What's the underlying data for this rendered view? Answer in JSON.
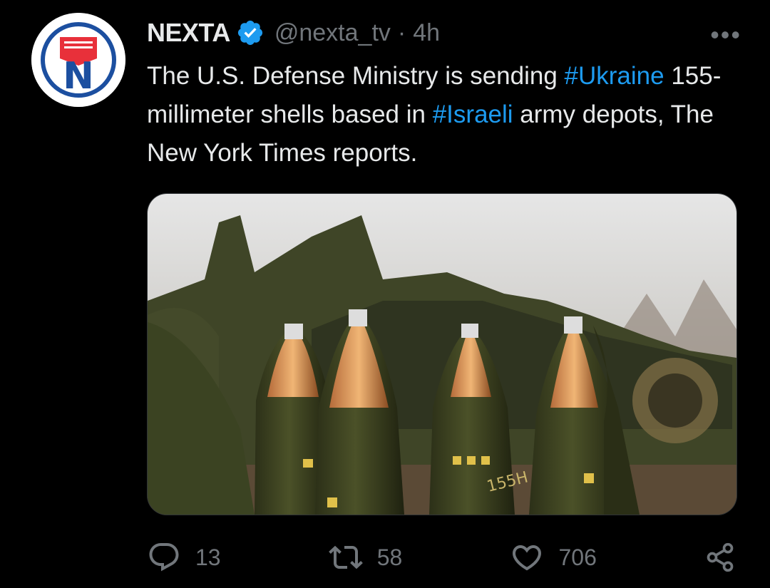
{
  "author": {
    "name": "NEXTA",
    "handle": "@nexta_tv",
    "separator": "·",
    "time": "4h",
    "avatar_letter": "N"
  },
  "tweet": {
    "segments": [
      {
        "text": "The U.S. Defense Ministry is sending ",
        "type": "text"
      },
      {
        "text": "#Ukraine",
        "type": "hashtag"
      },
      {
        "text": " 155-millimeter shells based in ",
        "type": "text"
      },
      {
        "text": "#Israeli",
        "type": "hashtag"
      },
      {
        "text": " army depots, The New York Times reports.",
        "type": "text"
      }
    ]
  },
  "media": {
    "shell_marking": "155H"
  },
  "actions": {
    "reply_count": "13",
    "retweet_count": "58",
    "like_count": "706"
  },
  "icons": {
    "more": "more-horizontal-icon",
    "verified": "verified-badge-icon",
    "reply": "reply-icon",
    "retweet": "retweet-icon",
    "like": "heart-icon",
    "share": "share-icon"
  },
  "colors": {
    "background": "#000000",
    "text": "#e7e9ea",
    "muted": "#71767b",
    "accent": "#1d9bf0",
    "avatar_red": "#e8303a",
    "avatar_blue": "#1c4fa0"
  }
}
